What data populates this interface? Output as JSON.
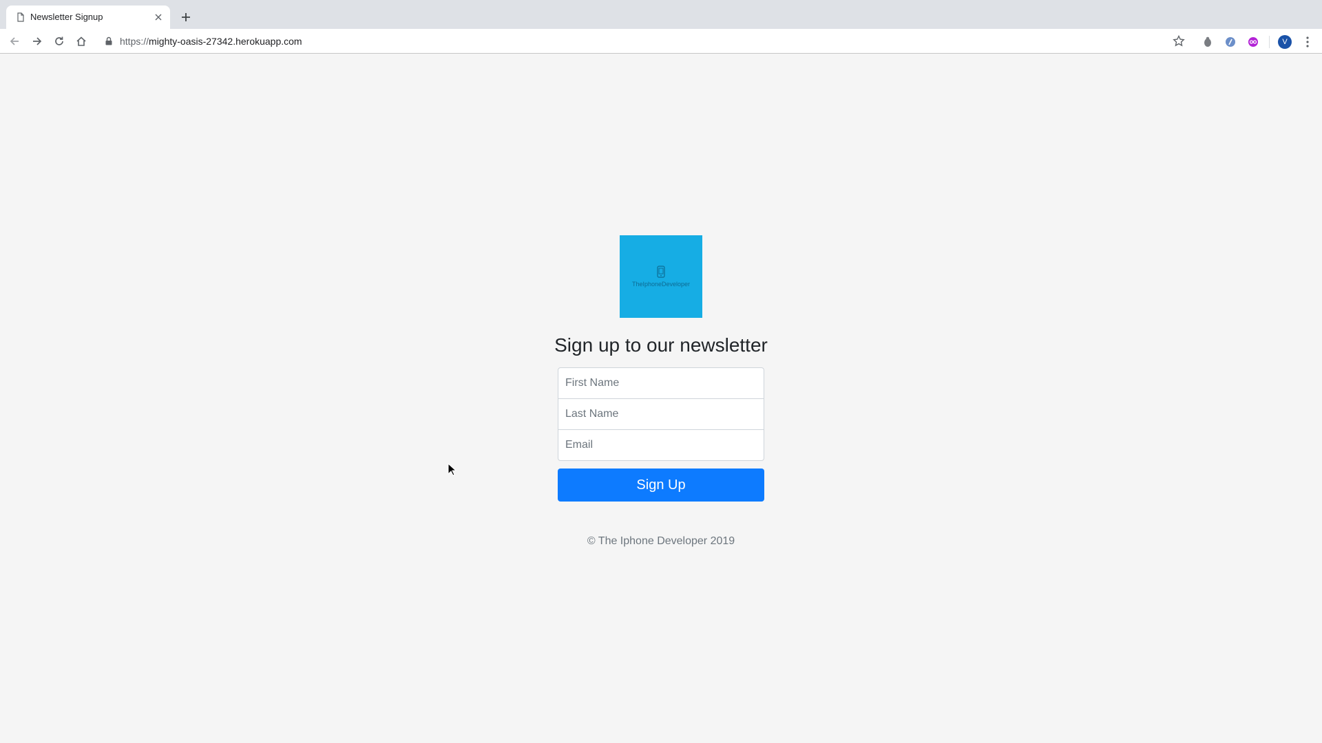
{
  "browser": {
    "tab_title": "Newsletter Signup",
    "url_scheme": "https://",
    "url_host": "mighty-oasis-27342.herokuapp.com",
    "avatar_letter": "V",
    "icons": [
      "page-icon",
      "close-icon",
      "plus-icon",
      "back-arrow-icon",
      "forward-arrow-icon",
      "reload-icon",
      "home-icon",
      "lock-icon",
      "star-icon",
      "extension-icon",
      "kebab-menu-icon"
    ]
  },
  "logo": {
    "text": "TheIphoneDeveloper",
    "background": "#16ade4"
  },
  "page": {
    "heading": "Sign up to our newsletter",
    "fields": {
      "first_name_placeholder": "First Name",
      "last_name_placeholder": "Last Name",
      "email_placeholder": "Email"
    },
    "signup_label": "Sign Up",
    "footer": "© The Iphone Developer 2019"
  },
  "colors": {
    "button": "#0d7bff",
    "page_background": "#f5f5f5"
  }
}
